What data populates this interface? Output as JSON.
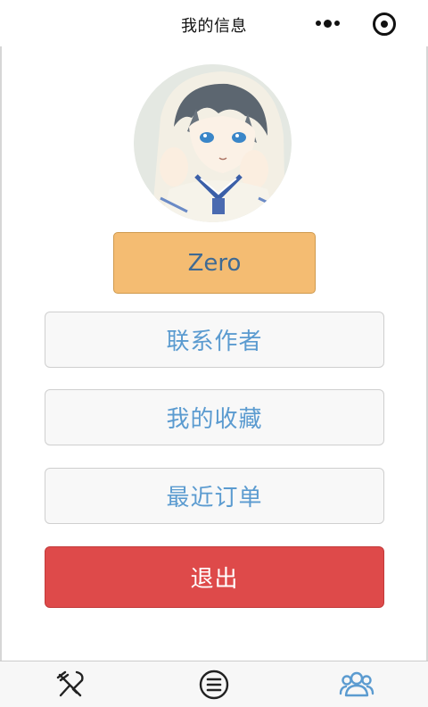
{
  "navbar": {
    "title": "我的信息",
    "menu_icon": "more-dots-icon",
    "close_icon": "capsule-close-icon"
  },
  "profile": {
    "avatar": "avatar",
    "username": "Zero"
  },
  "menu": {
    "contact_author": "联系作者",
    "my_favorites": "我的收藏",
    "recent_orders": "最近订单",
    "logout": "退出"
  },
  "tabbar": {
    "items": [
      {
        "label": "",
        "icon": "utensils-icon",
        "active": false
      },
      {
        "label": "",
        "icon": "menu-list-icon",
        "active": false
      },
      {
        "label": "",
        "icon": "users-icon",
        "active": true
      }
    ]
  },
  "colors": {
    "name_button_bg": "#f4bc72",
    "menu_text": "#5b9bd0",
    "logout_bg": "#de4a4a",
    "active_tab": "#5b9bd0"
  }
}
